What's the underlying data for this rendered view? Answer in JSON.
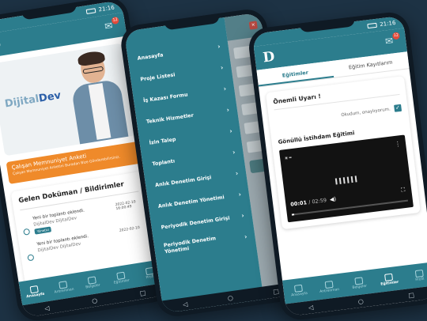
{
  "status": {
    "time_left": "21:16",
    "time_right": "21:16"
  },
  "notifications": {
    "badge_count": "12"
  },
  "phone1": {
    "hero_brand_prefix": "Dijital",
    "hero_brand_suffix": "Dev",
    "banner_title": "Çalışan Memnuniyet Anketi",
    "banner_subtitle": "Çalışan Memnuniyet Anketini Buradan Bize Gönderebilirsiniz.",
    "section_title": "Gelen Doküman / Bildirimler",
    "notices": [
      {
        "title": "Yeni bir toplantı eklendi.",
        "source": "DijitalDev DijitalDev",
        "badge": "Yönetici",
        "date": "2022-02-10 16:00:49"
      },
      {
        "title": "Yeni bir toplantı eklendi.",
        "source": "DijitalDev DijitalDev",
        "badge": "",
        "date": "2022-02-10"
      }
    ]
  },
  "nav": [
    {
      "label": "Anasayfa"
    },
    {
      "label": "Antrenman"
    },
    {
      "label": "Belgeler"
    },
    {
      "label": "Eğitimler"
    },
    {
      "label": "Profil"
    }
  ],
  "drawer": {
    "items": [
      {
        "label": "Anasayfa"
      },
      {
        "label": "Proje Listesi"
      },
      {
        "label": "İş Kazası Formu"
      },
      {
        "label": "Teknik Hizmetler"
      },
      {
        "label": "İzin Talep"
      },
      {
        "label": "Toplantı"
      },
      {
        "label": "Anlık Denetim Girişi"
      },
      {
        "label": "Anlık Denetim Yönetimi"
      },
      {
        "label": "Periyodik Denetim Girişi"
      },
      {
        "label": "Periyodik Denetim Yönetimi"
      }
    ]
  },
  "phone3": {
    "tabs": [
      {
        "label": "Eğitimler",
        "active": true
      },
      {
        "label": "Eğitim Kayıtlarım",
        "active": false
      }
    ],
    "warning_title": "Önemli Uyarı !",
    "acknowledge_label": "Okudum, onaylıyorum.",
    "training_title": "Gönüllü İstihdam Eğitimi",
    "video": {
      "current": "00:01",
      "total": "/ 02:59",
      "progress": 0.01
    }
  }
}
